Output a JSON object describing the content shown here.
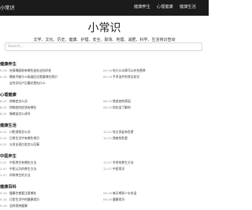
{
  "header": {
    "brand": "小常识",
    "nav": [
      "健康养生",
      "心理健康",
      "健康生活"
    ]
  },
  "hero": {
    "title": "小常识",
    "subtitle": "文学、文化、历史、健康、护理、安全、职场、地理、减肥、科学、生活常识查询",
    "search_placeholder": "Search..."
  },
  "sections": [
    {
      "title": "健康养生",
      "left": [
        {
          "date": "9-16",
          "text": "吃青稞面粉有哪些益处这些好处"
        },
        {
          "date": "9-16",
          "text": "睡前不能什么吸烟后还需要哪些常识"
        },
        {
          "date": "",
          "text": "女性孕妇产后最好是吃什么"
        }
      ],
      "right": [
        {
          "date": "09-16",
          "text": "吃什么水果可以补充营养"
        },
        {
          "date": "09-16",
          "text": "手术治疗的常见知识"
        }
      ]
    },
    {
      "title": "心理健康",
      "left": [
        {
          "date": "8-25",
          "text": "抑郁症怎么治"
        },
        {
          "date": "8-25",
          "text": "抑郁症的症状有哪些"
        },
        {
          "date": "8-25",
          "text": "情绪该怎么调节"
        }
      ],
      "right": [
        {
          "date": "08-25",
          "text": "焦虑症的原因"
        },
        {
          "date": "08-25",
          "text": "你应该了解的"
        }
      ]
    },
    {
      "title": "健康生活",
      "left": [
        {
          "date": "0-22",
          "text": "口腔溃疡怎么办"
        },
        {
          "date": "0-22",
          "text": "日常生活中有哪些常识"
        },
        {
          "date": "0-22",
          "text": "头发出现白发怎么回事"
        }
      ],
      "right": [
        {
          "date": "10-22",
          "text": "吃太多盐有危害"
        },
        {
          "date": "10-22",
          "text": "熬夜的危害"
        }
      ]
    },
    {
      "title": "中医养生",
      "left": [
        {
          "date": "2-07",
          "text": "中医养生有哪些方法"
        },
        {
          "date": "2-07",
          "text": "中医认为的养生方法"
        },
        {
          "date": "2-07",
          "text": "四季养生的方法"
        }
      ],
      "right": [
        {
          "date": "12-07",
          "text": "冬季的养生方法"
        },
        {
          "date": "12-07",
          "text": "中医常识"
        }
      ]
    },
    {
      "title": "健康百科",
      "left": [
        {
          "date": "9-16",
          "text": "健康饮食要注意哪些"
        },
        {
          "date": "9-16",
          "text": "日常生活中的健康常识"
        },
        {
          "date": "9-16",
          "text": "怎样保持健康"
        }
      ],
      "right": [
        {
          "date": "09-16",
          "text": "每天喝多少水合适"
        },
        {
          "date": "09-16",
          "text": "健康常识"
        }
      ]
    }
  ]
}
